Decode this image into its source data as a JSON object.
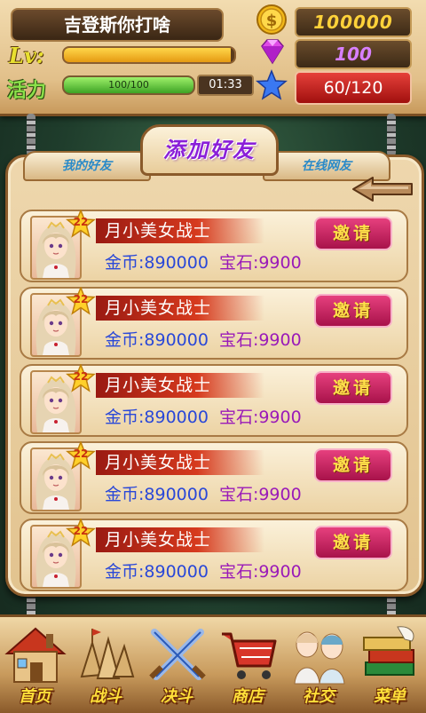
{
  "player": {
    "name": "吉登斯你打啥",
    "lv_label": "Lv:",
    "lv_progress": 0.98,
    "vitality_label": "活力",
    "vitality_text": "100/100",
    "vitality_progress": 1.0,
    "timer": "01:33"
  },
  "resources": {
    "gold": "100000",
    "gems": "100",
    "stars": "60/120",
    "gold_icon": "gold-coin-icon",
    "gem_icon": "diamond-icon",
    "star_icon": "blue-star-icon"
  },
  "tabs": {
    "my_friends": "我的好友",
    "add_friend": "添加好友",
    "online": "在线网友"
  },
  "friends": [
    {
      "level": "22",
      "name": "月小美女战士",
      "gold_label": "金币:",
      "gold": "890000",
      "gem_label": "宝石:",
      "gems": "9900",
      "invite": "邀请"
    },
    {
      "level": "22",
      "name": "月小美女战士",
      "gold_label": "金币:",
      "gold": "890000",
      "gem_label": "宝石:",
      "gems": "9900",
      "invite": "邀请"
    },
    {
      "level": "22",
      "name": "月小美女战士",
      "gold_label": "金币:",
      "gold": "890000",
      "gem_label": "宝石:",
      "gems": "9900",
      "invite": "邀请"
    },
    {
      "level": "22",
      "name": "月小美女战士",
      "gold_label": "金币:",
      "gold": "890000",
      "gem_label": "宝石:",
      "gems": "9900",
      "invite": "邀请"
    },
    {
      "level": "22",
      "name": "月小美女战士",
      "gold_label": "金币:",
      "gold": "890000",
      "gem_label": "宝石:",
      "gems": "9900",
      "invite": "邀请"
    }
  ],
  "nav": [
    {
      "label": "首页",
      "icon": "house-icon"
    },
    {
      "label": "战斗",
      "icon": "army-icon"
    },
    {
      "label": "决斗",
      "icon": "crossed-swords-icon"
    },
    {
      "label": "商店",
      "icon": "shopping-cart-icon"
    },
    {
      "label": "社交",
      "icon": "characters-icon"
    },
    {
      "label": "菜单",
      "icon": "books-icon"
    }
  ],
  "colors": {
    "accent_gold": "#ffd23a",
    "gem_purple": "#d880ff",
    "star_red": "#c4201a",
    "invite_pink": "#c8205c",
    "tab_purple": "#8a1fd8"
  }
}
